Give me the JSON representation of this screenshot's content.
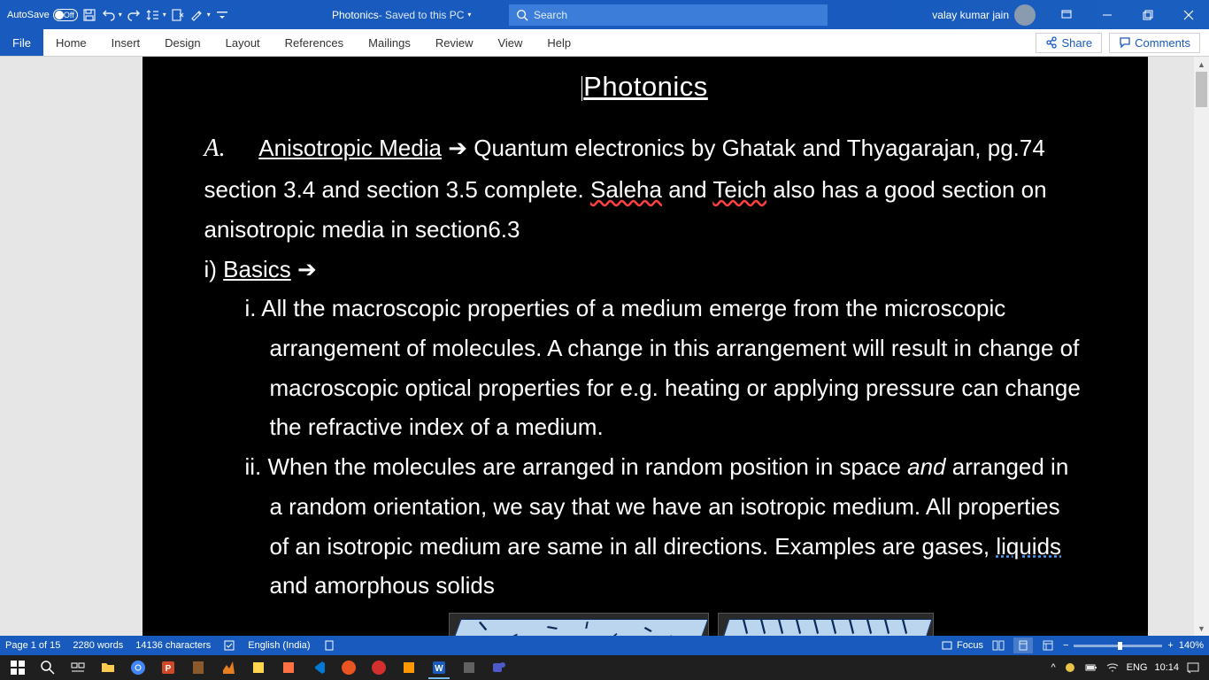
{
  "titlebar": {
    "autosave_label": "AutoSave",
    "autosave_state": "Off",
    "doc_name": "Photonics",
    "doc_status": " - Saved to this PC",
    "search_placeholder": "Search",
    "user_name": "valay kumar jain"
  },
  "ribbon": {
    "tabs": [
      "File",
      "Home",
      "Insert",
      "Design",
      "Layout",
      "References",
      "Mailings",
      "Review",
      "View",
      "Help"
    ],
    "share": "Share",
    "comments": "Comments"
  },
  "doc": {
    "title": "Photonics",
    "list_letter": "A.",
    "heading_a": "Anisotropic Media",
    "arrow": "➔",
    "line_a_rest1": " Quantum electronics by Ghatak and Thyagarajan, pg.74 section 3.4 and section 3.5 complete. ",
    "saleha": "Saleha",
    "line_a_mid": " and ",
    "teich": "Teich",
    "line_a_rest2": " also has a good section on anisotropic media in section6.3",
    "sub_i_label": "i) ",
    "sub_i_head": "Basics",
    "item_i_label": "i. ",
    "item_i_text": "All the macroscopic properties of a medium emerge from the microscopic arrangement of molecules. A change in this arrangement will result in change of macroscopic optical properties for e.g. heating or applying pressure can change the refractive index of a medium.",
    "item_ii_label": "ii. ",
    "item_ii_text1": "When the molecules are arranged in random position in space ",
    "item_ii_and": "and",
    "item_ii_text2": " arranged in a random orientation, we say that we have an isotropic medium. All properties of an isotropic medium are same in all directions. Examples are gases, ",
    "item_ii_liquids": "liquids",
    "item_ii_text3": " and amorphous solids"
  },
  "statusbar": {
    "page": "Page 1 of 15",
    "words": "2280 words",
    "chars": "14136 characters",
    "lang": "English (India)",
    "focus": "Focus",
    "zoom": "140%"
  },
  "taskbar": {
    "lang": "ENG",
    "time": "10:14"
  }
}
